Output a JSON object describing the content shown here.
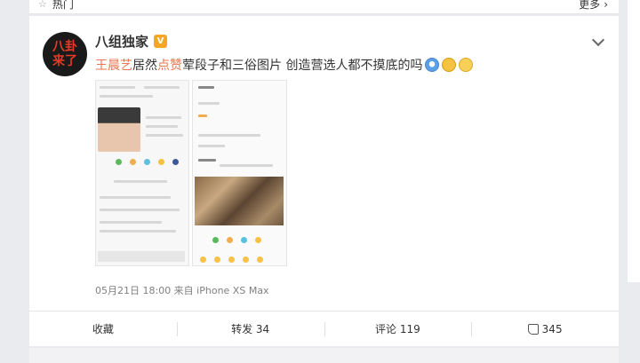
{
  "topbar": {
    "hot_label": "热门",
    "more_label": "更多"
  },
  "post": {
    "avatar_text": [
      "八卦",
      "来了"
    ],
    "author": "八组独家",
    "verified_badge": "V",
    "content": {
      "segment1": "王晨艺",
      "segment2": "居然",
      "segment3": "点赞",
      "segment4": "荤段子和三俗图片 创造营选人都不摸底的吗"
    },
    "timestamp": "05月21日 18:00 来自 iPhone XS Max"
  },
  "actions": {
    "collect": "收藏",
    "repost": "转发 34",
    "comment": "评论 119",
    "like": "345"
  },
  "colors": {
    "accent": "#eb7350",
    "text": "#333333",
    "meta": "#808080"
  }
}
